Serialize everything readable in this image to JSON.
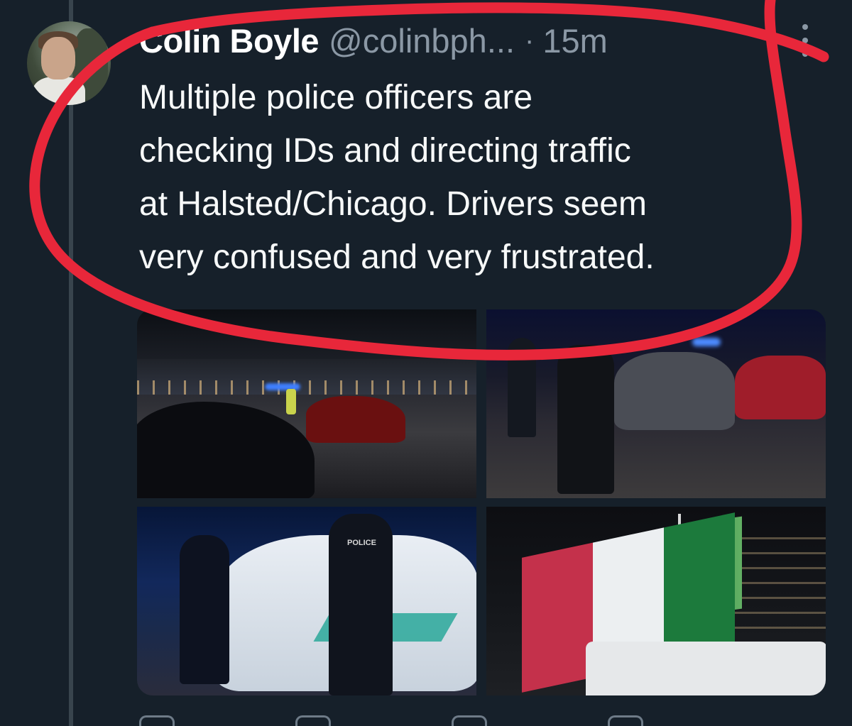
{
  "tweet": {
    "author_name": "Colin Boyle",
    "author_handle": "@colinbph...",
    "separator": "·",
    "timestamp": "15m",
    "text_lines": [
      "Multiple police officers are",
      "checking IDs and directing traffic",
      "at Halsted/Chicago. Drivers seem",
      "very confused and very frustrated."
    ],
    "photo_count": 4,
    "photo_3_label": "POLICE"
  },
  "icons": {
    "more": "more-vertical-icon",
    "avatar": "profile-avatar"
  },
  "colors": {
    "background": "#16202a",
    "primary_text": "#f7f9f9",
    "secondary_text": "#8b98a5",
    "annotation_red": "#e8273a",
    "thread_line": "#38444d"
  }
}
